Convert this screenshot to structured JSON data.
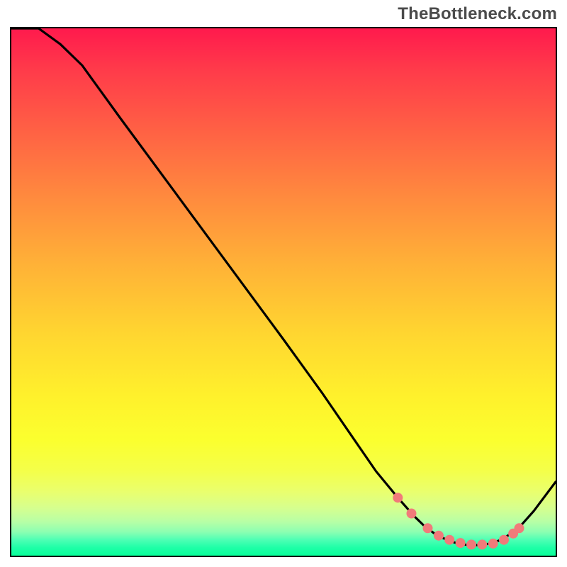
{
  "watermark": "TheBottleneck.com",
  "chart_data": {
    "type": "line",
    "title": "",
    "xlabel": "",
    "ylabel": "",
    "xlim": [
      0,
      100
    ],
    "ylim": [
      0,
      100
    ],
    "grid": false,
    "legend": null,
    "series": [
      {
        "name": "curve",
        "x": [
          0,
          5,
          9,
          13,
          20,
          30,
          40,
          50,
          57,
          63,
          67,
          71,
          74,
          76,
          78,
          80,
          82,
          84,
          86,
          88,
          90,
          93,
          96,
          100
        ],
        "values": [
          100,
          100,
          97,
          93,
          83,
          69,
          55,
          41,
          31,
          22,
          16,
          11,
          7.5,
          5.5,
          4,
          3,
          2.3,
          2,
          2,
          2.3,
          3,
          5,
          8.5,
          14
        ]
      }
    ],
    "markers": {
      "name": "highlight-dots",
      "x": [
        71,
        73.5,
        76.5,
        78.5,
        80.5,
        82.5,
        84.5,
        86.5,
        88.5,
        90.5,
        92.2,
        93.3
      ],
      "values": [
        11,
        8,
        5.2,
        3.8,
        3,
        2.4,
        2.1,
        2.1,
        2.3,
        3,
        4.2,
        5.2
      ],
      "color": "#f17a7a",
      "radius": 7
    },
    "gradient_stops": [
      {
        "pos": 0,
        "color": "#ff1a4d"
      },
      {
        "pos": 0.5,
        "color": "#ffd630"
      },
      {
        "pos": 0.85,
        "color": "#f4ff4a"
      },
      {
        "pos": 1,
        "color": "#0aff9a"
      }
    ]
  }
}
